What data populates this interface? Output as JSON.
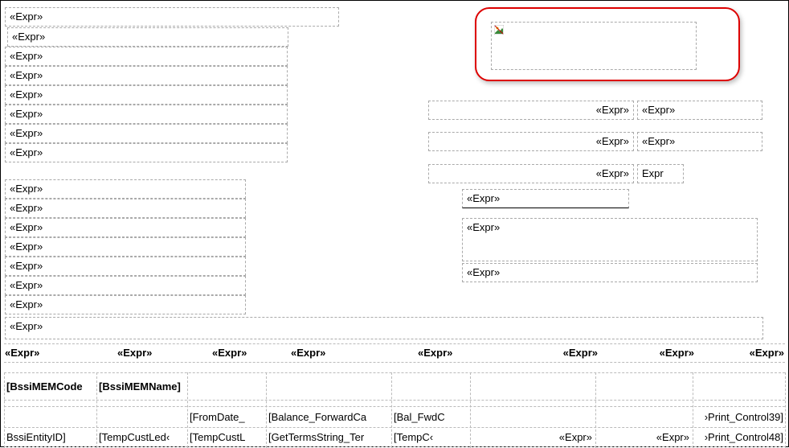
{
  "expr": "«Expr»",
  "exprPlain": "Expr",
  "leftTop": [
    "«Expr»",
    "«Expr»",
    "«Expr»",
    "«Expr»",
    "«Expr»",
    "«Expr»",
    "«Expr»",
    "«Expr»"
  ],
  "leftMid": [
    "«Expr»",
    "«Expr»",
    "«Expr»",
    "«Expr»",
    "«Expr»",
    "«Expr»",
    "«Expr»"
  ],
  "longExpr": "«Expr»",
  "rightPair1": {
    "a": "«Expr»",
    "b": "«Expr»"
  },
  "rightPair2": {
    "a": "«Expr»",
    "b": "«Expr»"
  },
  "rightPair3": {
    "a": "«Expr»",
    "b": "Expr"
  },
  "rightBlock": [
    "«Expr»",
    "«Expr»",
    "«Expr»"
  ],
  "headerRow": [
    "«Expr»",
    "«Expr»",
    "«Expr»",
    "«Expr»",
    "«Expr»",
    "«Expr»",
    "«Expr»",
    "«Expr»"
  ],
  "gridRow1": {
    "c0": "[BssiMEMCode",
    "c1": "[BssiMEMName]"
  },
  "gridRow2": {
    "c2": "[FromDate_",
    "c3": "[Balance_ForwardCa",
    "c4": "[Bal_FwdC",
    "c7": "›Print_Control39]"
  },
  "gridRow3": {
    "c0": "BssiEntityID]",
    "c1": "[TempCustLed‹",
    "c2": "[TempCustL",
    "c3": "[GetTermsString_Ter",
    "c4": "[TempC‹",
    "c5": "«Expr»",
    "c6": "«Expr»",
    "c7": "›Print_Control48]"
  }
}
